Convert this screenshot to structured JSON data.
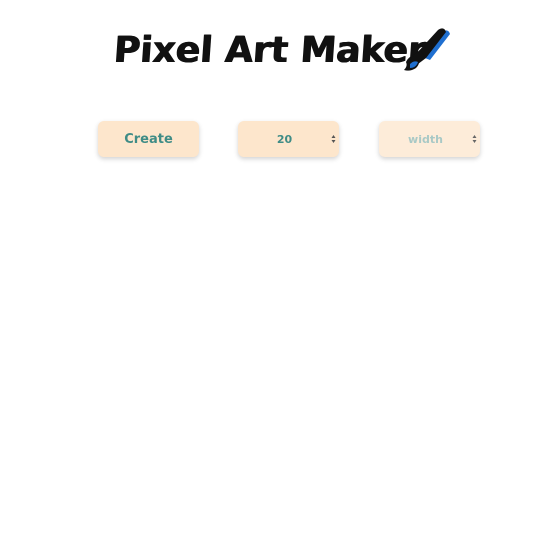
{
  "header": {
    "title": "Pixel Art Maker"
  },
  "controls": {
    "create_label": "Create",
    "height_value": "20",
    "width_placeholder": "width"
  },
  "colors": {
    "button_bg": "#fde6cc",
    "button_text": "#3f8c86",
    "brush_accent": "#1f6fd0"
  },
  "icons": {
    "brush": "paintbrush-icon",
    "spinner": "number-spinner-icon"
  }
}
